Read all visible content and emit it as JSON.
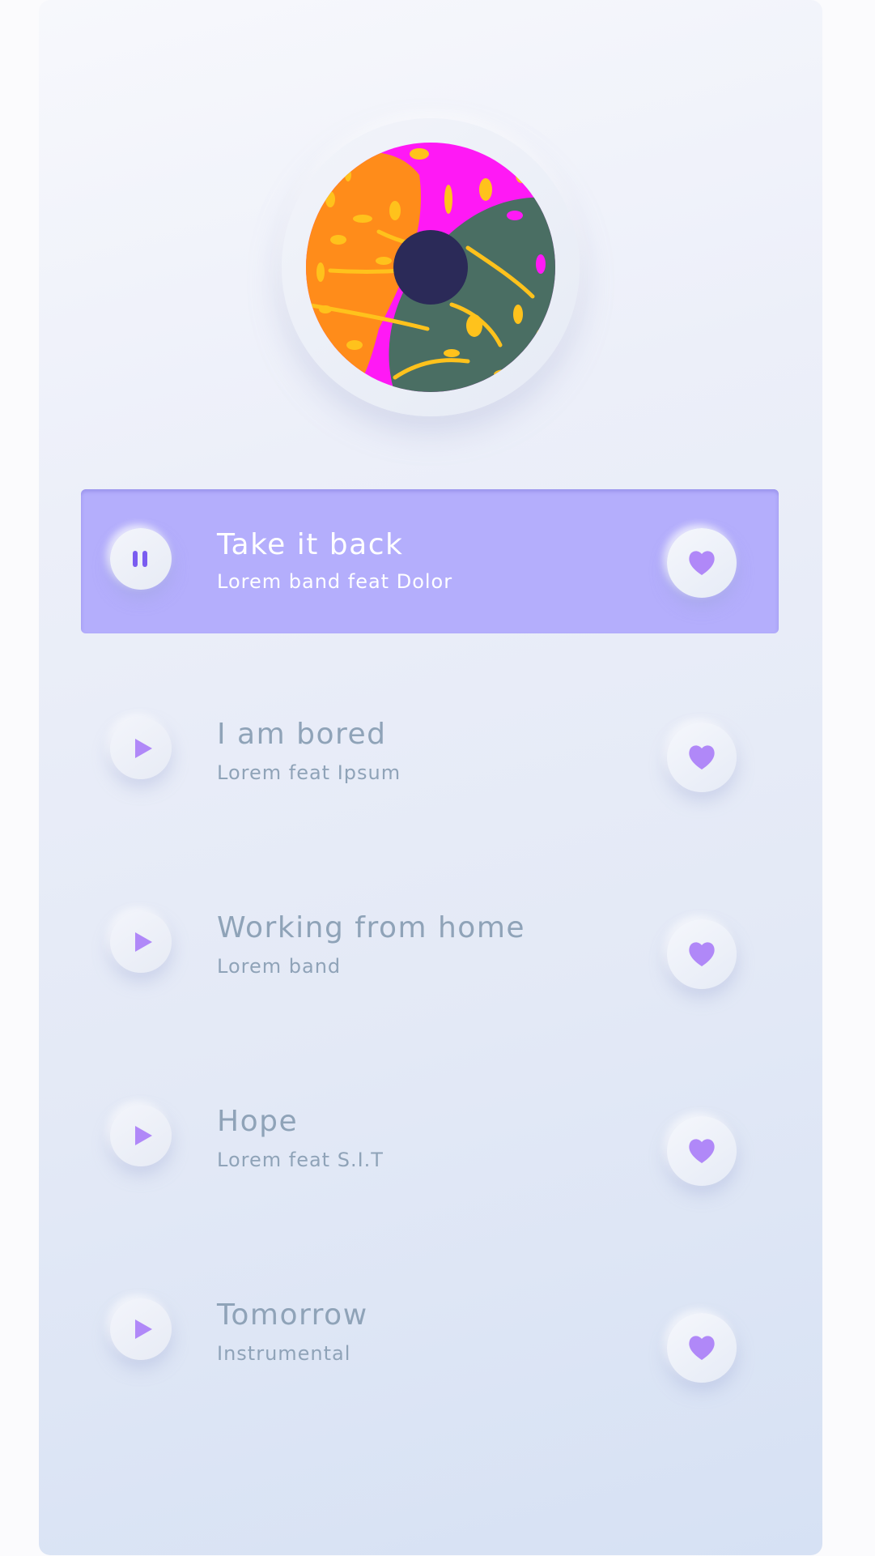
{
  "colors": {
    "accent": "#b4aefc",
    "text_muted": "#8fa3b8",
    "icon_purple": "#b088f8",
    "pause_icon": "#7a5cf0",
    "disc_center": "#2b2a58"
  },
  "album": {
    "art_icon": "album-art-leaves"
  },
  "tracks": [
    {
      "title": "Take it back",
      "artist": "Lorem band feat Dolor",
      "state": "playing",
      "action_icon": "pause-icon",
      "like_icon": "heart-icon"
    },
    {
      "title": "I am bored",
      "artist": "Lorem feat Ipsum",
      "state": "stopped",
      "action_icon": "play-icon",
      "like_icon": "heart-icon"
    },
    {
      "title": "Working from home",
      "artist": "Lorem band",
      "state": "stopped",
      "action_icon": "play-icon",
      "like_icon": "heart-icon"
    },
    {
      "title": "Hope",
      "artist": "Lorem feat S.I.T",
      "state": "stopped",
      "action_icon": "play-icon",
      "like_icon": "heart-icon"
    },
    {
      "title": "Tomorrow",
      "artist": "Instrumental",
      "state": "stopped",
      "action_icon": "play-icon",
      "like_icon": "heart-icon"
    }
  ]
}
